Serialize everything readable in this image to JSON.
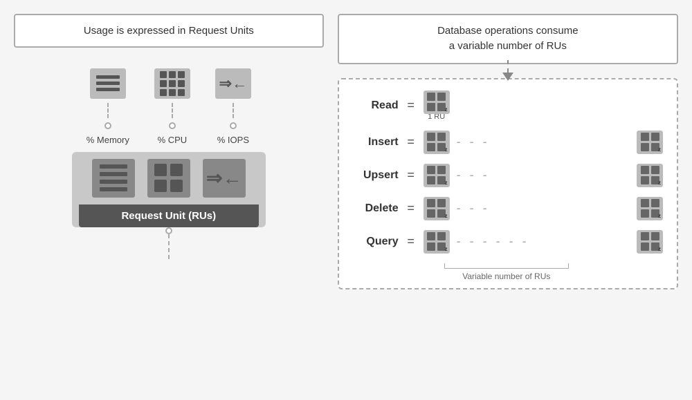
{
  "left": {
    "title": "Usage is expressed in Request Units",
    "resources": [
      {
        "label": "% Memory",
        "type": "memory"
      },
      {
        "label": "% CPU",
        "type": "cpu"
      },
      {
        "label": "% IOPS",
        "type": "iops"
      }
    ],
    "ru_label": "Request Unit (RUs)"
  },
  "right": {
    "title": "Database operations consume\na variable number of RUs",
    "operations": [
      {
        "label": "Read",
        "equals": "=",
        "single": true,
        "ru_label": "1 RU"
      },
      {
        "label": "Insert",
        "equals": "=",
        "single": false
      },
      {
        "label": "Upsert",
        "equals": "=",
        "single": false
      },
      {
        "label": "Delete",
        "equals": "=",
        "single": false
      },
      {
        "label": "Query",
        "equals": "=",
        "single": false,
        "long_dash": true
      }
    ],
    "variable_label": "Variable number of RUs"
  }
}
